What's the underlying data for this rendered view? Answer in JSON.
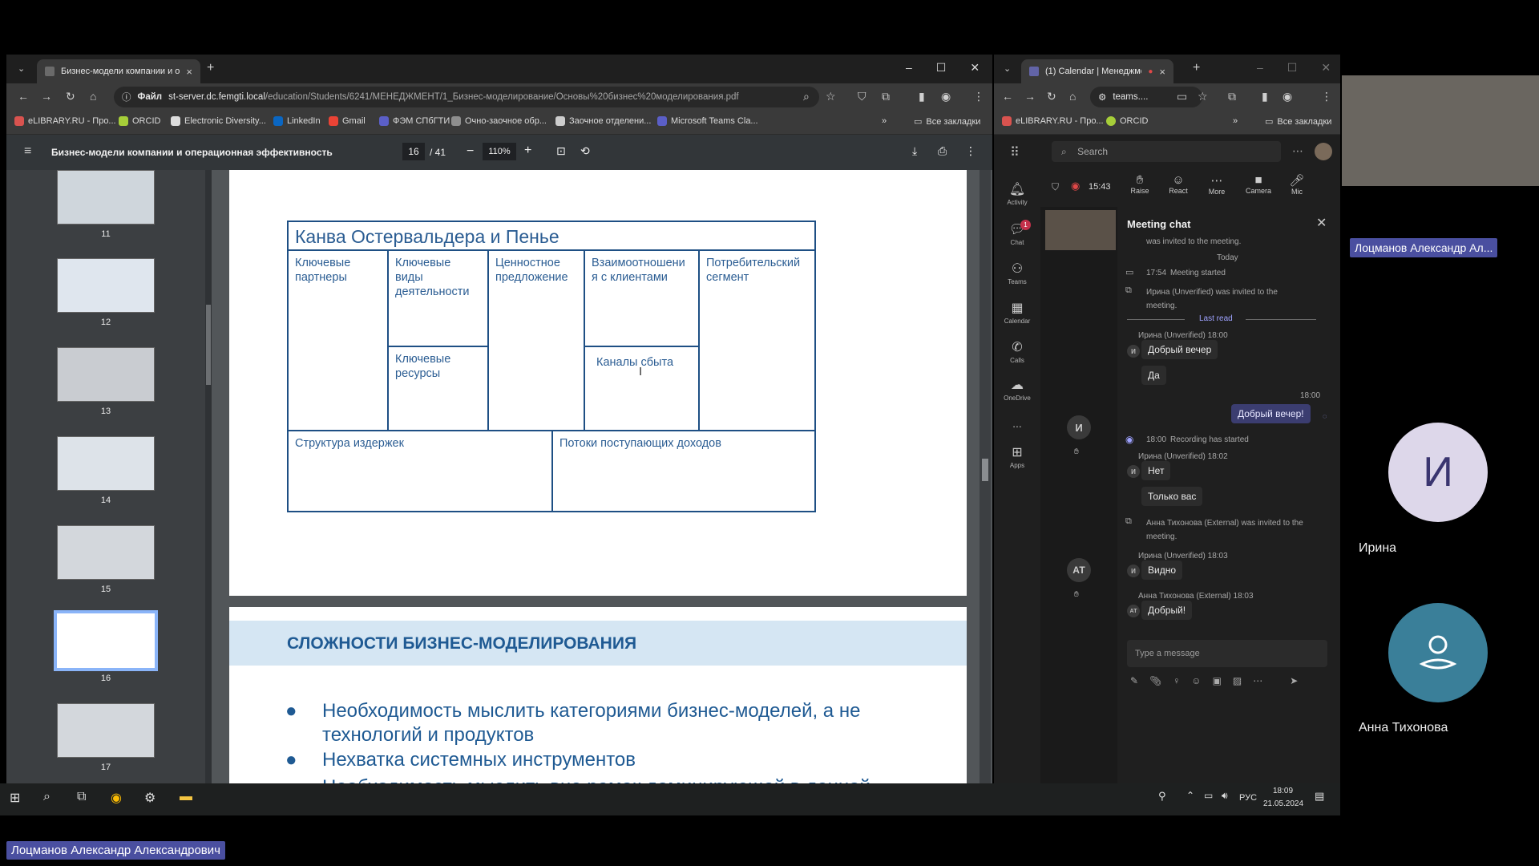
{
  "left_browser": {
    "tab_title": "Бизнес-модели компании и о",
    "address_prefix": "Файл",
    "address_host": "st-server.dc.femgti.local",
    "address_path": "/education/Students/6241/МЕНЕДЖМЕНТ/1_Бизнес-моделирование/Основы%20бизнес%20моделирования.pdf",
    "bookmarks": [
      "eLIBRARY.RU - Про...",
      "ORCID",
      "Electronic Diversity...",
      "LinkedIn",
      "Gmail",
      "ФЭМ СПбГТИ",
      "Очно-заочное обр...",
      "Заочное отделени...",
      "Microsoft Teams Cla..."
    ],
    "bookmarks_more": "»",
    "all_bookmarks": "Все закладки"
  },
  "pdf": {
    "title": "Бизнес-модели компании и операционная эффективность",
    "page_current": "16",
    "page_total": "/ 41",
    "zoom": "110%",
    "thumb_numbers": [
      "11",
      "12",
      "13",
      "14",
      "15",
      "16",
      "17"
    ],
    "canvas": {
      "title": "Канва Остервальдера и  Пенье",
      "key_partners": "Ключевые партнеры",
      "key_activities": "Ключевые виды деятельности",
      "value_prop": "Ценностное предложение",
      "relations": "Взаимоотношени я с клиентами",
      "segments": "Потребительский сегмент",
      "key_resources": "Ключевые ресурсы",
      "channels": "Каналы сбыта",
      "costs": "Структура издержек",
      "revenue": "Потоки поступающих доходов"
    },
    "slide2": {
      "heading": "СЛОЖНОСТИ БИЗНЕС-МОДЕЛИРОВАНИЯ",
      "bullets": [
        "Необходимость мыслить категориями бизнес-моделей, а не технологий и продуктов",
        "Нехватка системных инструментов",
        "Необходимость мыслить вне рамок доминирующей в данной отрасли логики"
      ]
    }
  },
  "right_browser": {
    "tab_title": "(1) Calendar | Менеджмен",
    "address": "teams....",
    "bookmarks": [
      "eLIBRARY.RU - Про...",
      "ORCID"
    ],
    "bookmarks_more": "»",
    "all_bookmarks": "Все закладки"
  },
  "teams": {
    "search_placeholder": "Search",
    "timer": "15:43",
    "controls": [
      "Raise",
      "React",
      "More",
      "Camera",
      "Mic"
    ],
    "rail": [
      "Activity",
      "Chat",
      "Teams",
      "Calendar",
      "Calls",
      "OneDrive",
      "...",
      "Apps"
    ],
    "chat_badge": "1",
    "chat_title": "Meeting chat",
    "invited_top": "was invited to the meeting.",
    "today": "Today",
    "meeting_started_time": "17:54",
    "meeting_started": "Meeting started",
    "irina_invited": "Ирина (Unverified) was invited to the meeting.",
    "last_read": "Last read",
    "msg1_meta": "Ирина (Unverified)  18:00",
    "msg1a": "Добрый вечер",
    "msg1b": "Да",
    "self_time": "18:00",
    "self_msg": "Добрый вечер!",
    "rec_time": "18:00",
    "rec_text": "Recording has started",
    "msg2_meta": "Ирина (Unverified)  18:02",
    "msg2a": "Нет",
    "msg2b": "Только вас",
    "anna_invited": "Анна Тихонова (External) was invited to the meeting.",
    "msg3_meta": "Ирина (Unverified)  18:03",
    "msg3a": "Видно",
    "msg4_meta": "Анна Тихонова (External)  18:03",
    "msg4a": "Добрый!",
    "compose_placeholder": "Type a message",
    "avatar_i": "И",
    "avatar_at": "АТ"
  },
  "participants": {
    "presenter_label": "Лоцманов Александр Ал...",
    "irina_initial": "И",
    "irina_name": "Ирина",
    "anna_name": "Анна Тихонова",
    "bottom_label": "Лоцманов Александр Александрович"
  },
  "taskbar": {
    "lang": "РУС",
    "time": "18:09",
    "date": "21.05.2024"
  },
  "colors": {
    "teams_purple": "#6264a7",
    "pdf_blue": "#1e4f84",
    "slide_band": "#d5e6f3"
  }
}
